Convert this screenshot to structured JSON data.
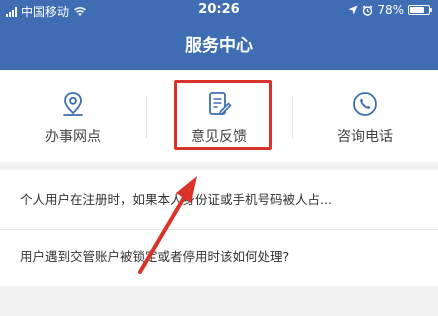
{
  "status_bar": {
    "carrier": "中国移动",
    "time": "20:26",
    "battery": "78%",
    "battery_level": 0.78
  },
  "header": {
    "title": "服务中心"
  },
  "quick_actions": [
    {
      "label": "办事网点",
      "icon": "location-pin-icon"
    },
    {
      "label": "意见反馈",
      "icon": "feedback-note-icon"
    },
    {
      "label": "咨询电话",
      "icon": "phone-icon"
    }
  ],
  "faq": [
    "个人用户在注册时，如果本人身份证或手机号码被人占...",
    "用户遇到交管账户被锁定或者停用时该如何处理?"
  ],
  "colors": {
    "brand": "#3e6db3",
    "highlight": "#d9342b"
  }
}
